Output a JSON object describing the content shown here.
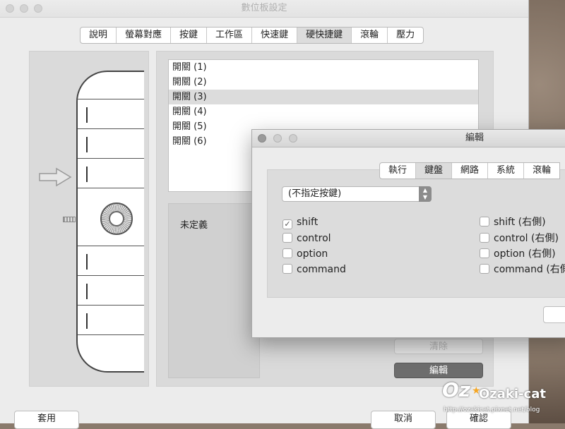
{
  "window": {
    "title": "數位板設定",
    "tabs": [
      "說明",
      "螢幕對應",
      "按鍵",
      "工作區",
      "快速鍵",
      "硬快捷鍵",
      "滾輪",
      "壓力"
    ],
    "active_tab": "硬快捷鍵"
  },
  "switches": [
    "開關 (1)",
    "開關 (2)",
    "開關 (3)",
    "開關 (4)",
    "開關 (5)",
    "開關 (6)"
  ],
  "selected_switch": "開關 (3)",
  "function_label": "未定義",
  "buttons": {
    "clear": "清除",
    "edit": "編輯",
    "apply": "套用",
    "cancel": "取消",
    "ok": "確認"
  },
  "dialog": {
    "title": "編輯",
    "tabs": [
      "執行",
      "鍵盤",
      "網路",
      "系統",
      "滾輪"
    ],
    "active_tab": "鍵盤",
    "key_select": "(不指定按鍵)",
    "modifiers_left": [
      {
        "label": "shift",
        "checked": true
      },
      {
        "label": "control",
        "checked": false
      },
      {
        "label": "option",
        "checked": false
      },
      {
        "label": "command",
        "checked": false
      }
    ],
    "modifiers_right": [
      {
        "label": "shift (右側)",
        "checked": false
      },
      {
        "label": "control (右側)",
        "checked": false
      },
      {
        "label": "option (右側)",
        "checked": false
      },
      {
        "label": "command (右側",
        "checked": false
      }
    ]
  },
  "watermark": {
    "name": "Ozaki-cat",
    "url": "http://ozakicat.pixnet.net/blog"
  }
}
